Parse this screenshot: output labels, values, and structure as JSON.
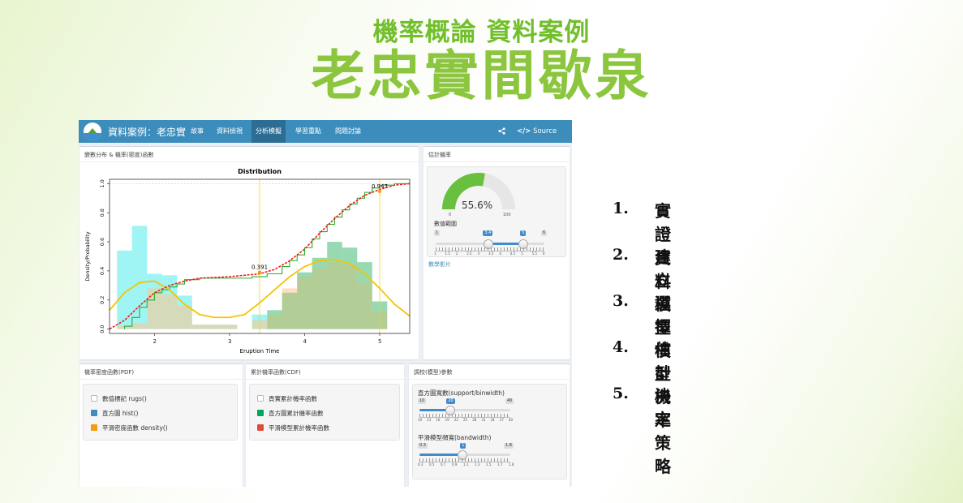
{
  "slide": {
    "subtitle": "機率概論 資料案例",
    "title": "老忠實間歇泉"
  },
  "navbar": {
    "brand": "資料案例：老忠實",
    "items": [
      {
        "label": "故事",
        "active": false
      },
      {
        "label": "資料檢視",
        "active": false
      },
      {
        "label": "分析模擬",
        "active": true
      },
      {
        "label": "學習重點",
        "active": false
      },
      {
        "label": "問題討論",
        "active": false
      }
    ],
    "source_label": "Source Code",
    "icons": {
      "share": "share-icon",
      "code": "code-icon"
    }
  },
  "dist_box": {
    "title": "變數分布 & 機率(密度)函數"
  },
  "chart_data": {
    "type": "bar",
    "title": "Distribution",
    "xlabel": "Eruption Time",
    "ylabel": "Density/Probability",
    "xlim": [
      1.4,
      5.4
    ],
    "ylim": [
      -0.03,
      1.03
    ],
    "xticks": [
      "2",
      "3",
      "4",
      "5"
    ],
    "yticks": [
      "0.0",
      "0.2",
      "0.4",
      "0.6",
      "0.8",
      "1.0"
    ],
    "grid": false,
    "hist": {
      "bin_width": 0.2,
      "bins": [
        {
          "x0": 1.5,
          "cyan": 0.54,
          "orange": 0.02
        },
        {
          "x0": 1.7,
          "cyan": 0.71,
          "orange": 0.04
        },
        {
          "x0": 1.9,
          "cyan": 0.38,
          "orange": 0.28
        },
        {
          "x0": 2.1,
          "cyan": 0.37,
          "orange": 0.24
        },
        {
          "x0": 2.3,
          "cyan": 0.23,
          "orange": 0.16
        },
        {
          "x0": 2.5,
          "cyan": 0.03,
          "orange": 0.03
        },
        {
          "x0": 2.7,
          "cyan": 0.03,
          "orange": 0.03
        },
        {
          "x0": 2.9,
          "cyan": 0.03,
          "orange": 0.03
        },
        {
          "x0": 3.3,
          "cyan": 0.1,
          "orange": 0.06
        },
        {
          "x0": 3.5,
          "cyan": 0.13,
          "orange": 0.1
        },
        {
          "x0": 3.7,
          "cyan": 0.25,
          "orange": 0.28
        },
        {
          "x0": 3.9,
          "cyan": 0.39,
          "orange": 0.36
        },
        {
          "x0": 4.1,
          "cyan": 0.49,
          "orange": 0.42
        },
        {
          "x0": 4.3,
          "cyan": 0.6,
          "orange": 0.46
        },
        {
          "x0": 4.5,
          "cyan": 0.56,
          "orange": 0.44
        },
        {
          "x0": 4.7,
          "cyan": 0.46,
          "orange": 0.32
        },
        {
          "x0": 4.9,
          "cyan": 0.19,
          "orange": 0.12
        }
      ]
    },
    "density_curve": {
      "color": "#f5c400",
      "x": [
        1.4,
        1.6,
        1.8,
        2.0,
        2.2,
        2.4,
        2.6,
        2.8,
        3.0,
        3.2,
        3.4,
        3.6,
        3.8,
        4.0,
        4.2,
        4.4,
        4.6,
        4.8,
        5.0,
        5.2,
        5.4
      ],
      "y": [
        0.13,
        0.25,
        0.32,
        0.33,
        0.27,
        0.17,
        0.1,
        0.08,
        0.08,
        0.1,
        0.18,
        0.27,
        0.36,
        0.43,
        0.47,
        0.48,
        0.45,
        0.38,
        0.28,
        0.17,
        0.09
      ]
    },
    "cdf_curve": {
      "color": "#e82020",
      "x": [
        1.4,
        1.6,
        1.8,
        2.0,
        2.2,
        2.4,
        2.6,
        2.8,
        3.0,
        3.2,
        3.4,
        3.6,
        3.8,
        4.0,
        4.2,
        4.4,
        4.6,
        4.8,
        5.0,
        5.2,
        5.4
      ],
      "y": [
        0.0,
        0.06,
        0.16,
        0.25,
        0.3,
        0.33,
        0.35,
        0.355,
        0.36,
        0.37,
        0.38,
        0.41,
        0.47,
        0.55,
        0.66,
        0.76,
        0.85,
        0.92,
        0.96,
        0.99,
        1.0
      ]
    },
    "ecdf_steps": {
      "color": "#2eae2e",
      "x": [
        1.6,
        1.7,
        1.8,
        1.9,
        2.0,
        2.1,
        2.2,
        2.3,
        2.4,
        2.6,
        3.3,
        3.5,
        3.7,
        3.8,
        3.9,
        4.0,
        4.1,
        4.2,
        4.3,
        4.4,
        4.5,
        4.6,
        4.7,
        4.8,
        4.9,
        5.0,
        5.2
      ],
      "y": [
        0.02,
        0.08,
        0.15,
        0.2,
        0.25,
        0.27,
        0.29,
        0.31,
        0.34,
        0.35,
        0.36,
        0.38,
        0.43,
        0.47,
        0.51,
        0.56,
        0.62,
        0.67,
        0.72,
        0.77,
        0.82,
        0.86,
        0.9,
        0.94,
        0.97,
        0.99,
        1.0
      ]
    },
    "vlines": [
      3.4,
      5.0
    ],
    "annotations": [
      {
        "x": 3.4,
        "y": 0.391,
        "label": "0.391"
      },
      {
        "x": 5.0,
        "y": 0.947,
        "label": "0.947"
      }
    ]
  },
  "estimate": {
    "box_title": "估計機率",
    "gauge_value": "55.6%",
    "gauge_fraction": 0.556,
    "gauge_min": "0",
    "gauge_max": "100",
    "range_label": "數值範圍",
    "range_min": "1",
    "range_max": "6",
    "range_from": "3.4",
    "range_to": "5",
    "range_low_value": 3.4,
    "range_high_value": 5,
    "range_ticks": [
      "1",
      "1.5",
      "2",
      "2.5",
      "3",
      "3.5",
      "4",
      "4.5",
      "5",
      "5.5",
      "6"
    ],
    "video_link": "教學影片"
  },
  "pdf_box": {
    "title": "機率密度函數(PDF)",
    "options": [
      {
        "label": "數值標記 rugs()",
        "checked": false
      },
      {
        "label": "直方圖 hist()",
        "checked": true
      },
      {
        "label": "平滑密度函數 density()",
        "checked": true
      }
    ]
  },
  "cdf_box": {
    "title": "累計機率函數(CDF)",
    "options": [
      {
        "label": "頁實累計機率函數",
        "checked": false
      },
      {
        "label": "直方圖累計機率函數",
        "checked": true
      },
      {
        "label": "平滑模型累計機率函數",
        "checked": true
      }
    ]
  },
  "params_box": {
    "title": "調校(模型)參數",
    "hist_label": "直方圖寬數(support/binwidth)",
    "hist_min": "10",
    "hist_max": "40",
    "hist_value": "20",
    "hist_value_num": 20,
    "hist_ticks": [
      "10",
      "13",
      "16",
      "19",
      "22",
      "25",
      "28",
      "31",
      "34",
      "37",
      "40"
    ],
    "bw_label": "平滑模型頻寬(bandwidth)",
    "bw_min": "0.3",
    "bw_max": "1.8",
    "bw_value": "1",
    "bw_value_num": 1,
    "bw_ticks": [
      "0.3",
      "0.5",
      "0.7",
      "0.9",
      "1.1",
      "1.3",
      "1.5",
      "1.7",
      "1.8"
    ]
  },
  "steps_list": [
    {
      "num": "1.",
      "label": "實證資料"
    },
    {
      "num": "2.",
      "label": "建立模型"
    },
    {
      "num": "3.",
      "label": "選擇模型"
    },
    {
      "num": "4.",
      "label": "估計機率"
    },
    {
      "num": "5.",
      "label": "決定策略"
    }
  ]
}
